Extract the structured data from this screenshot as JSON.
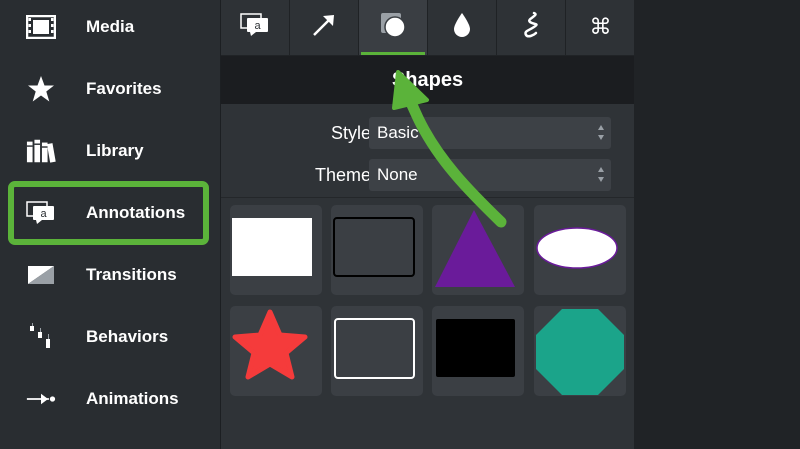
{
  "sidebar": {
    "items": [
      {
        "label": "Media",
        "icon": "film-strip-icon"
      },
      {
        "label": "Favorites",
        "icon": "star-icon"
      },
      {
        "label": "Library",
        "icon": "books-icon"
      },
      {
        "label": "Annotations",
        "icon": "speech-bubble-icon"
      },
      {
        "label": "Transitions",
        "icon": "transition-icon"
      },
      {
        "label": "Behaviors",
        "icon": "behaviors-icon"
      },
      {
        "label": "Animations",
        "icon": "animation-arrow-icon"
      }
    ],
    "selected": "Annotations",
    "annotation_badge": "a"
  },
  "toolbar": {
    "tools": [
      {
        "name": "callouts",
        "icon": "callout-bubble-icon"
      },
      {
        "name": "arrows-lines",
        "icon": "arrow-icon"
      },
      {
        "name": "shapes",
        "icon": "shapes-icon",
        "active": true
      },
      {
        "name": "blur-highlight",
        "icon": "drop-icon"
      },
      {
        "name": "sketch-motion",
        "icon": "squiggle-icon"
      },
      {
        "name": "keystroke",
        "icon": "command-key-icon",
        "glyph": "⌘"
      }
    ],
    "callout_badge": "a"
  },
  "panel": {
    "title": "Shapes",
    "style_label": "Style:",
    "style_value": "Basic",
    "theme_label": "Theme:",
    "theme_value": "None"
  },
  "shapes": [
    {
      "name": "filled-rectangle",
      "color": "#ffffff"
    },
    {
      "name": "outlined-rectangle",
      "color": "#000000"
    },
    {
      "name": "triangle",
      "color": "#6a1b9a"
    },
    {
      "name": "ellipse",
      "color": "#ffffff"
    },
    {
      "name": "star",
      "color": "#f53b3b"
    },
    {
      "name": "white-outlined-rectangle",
      "color": "#ffffff"
    },
    {
      "name": "black-rectangle",
      "color": "#000000"
    },
    {
      "name": "octagon",
      "color": "#1ba48a"
    }
  ],
  "colors": {
    "accent": "#5bb33a"
  }
}
